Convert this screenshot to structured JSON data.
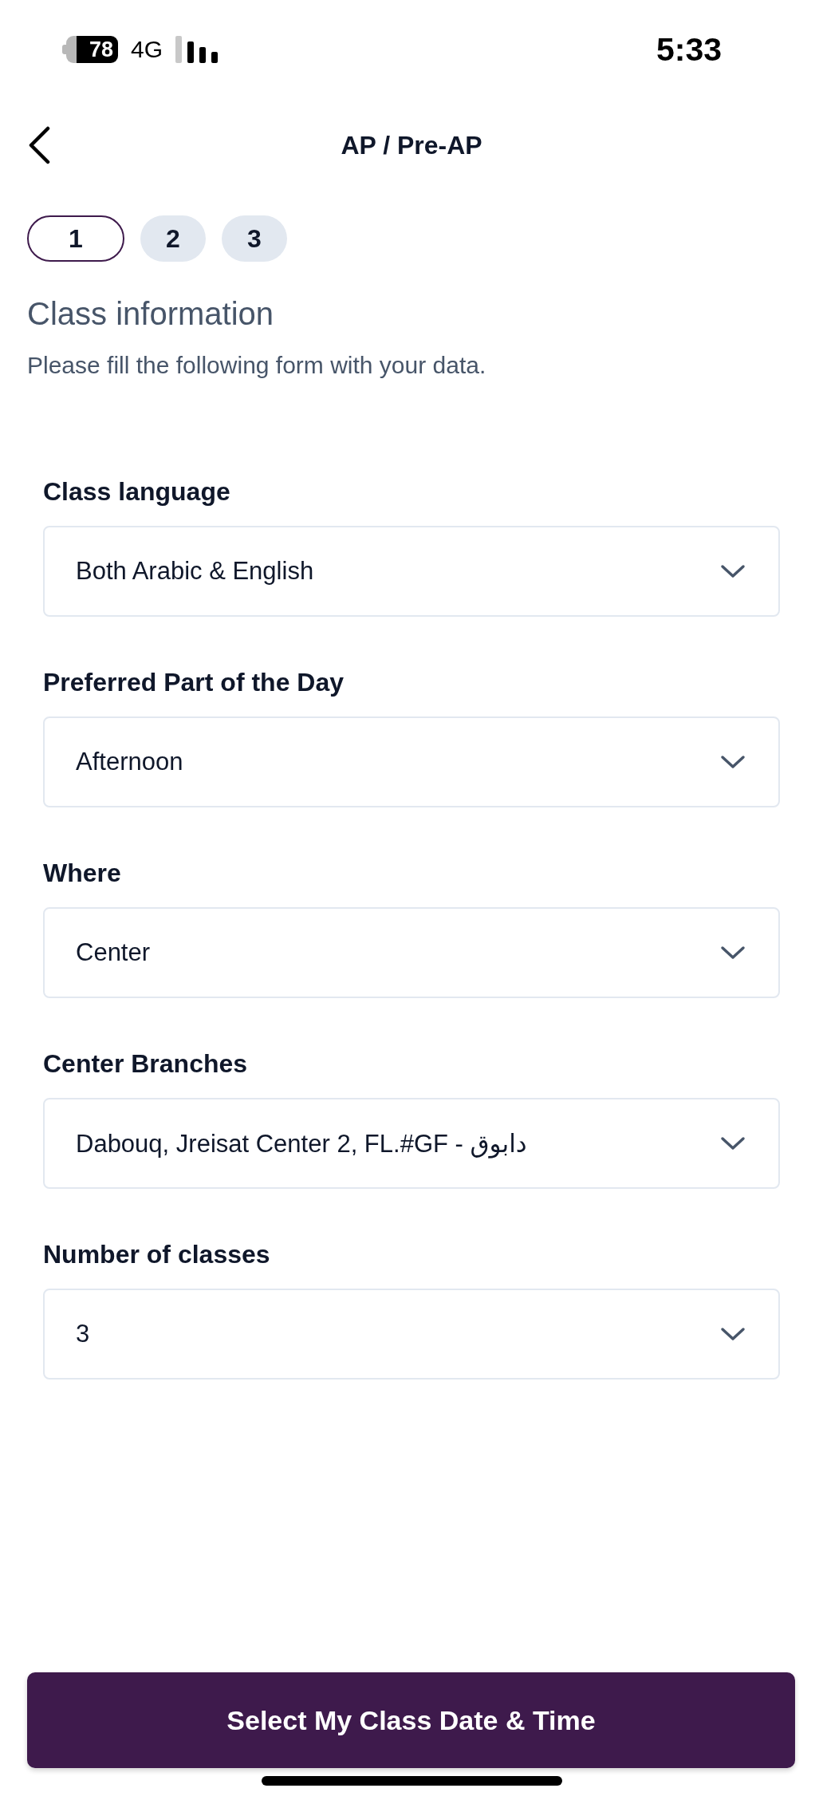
{
  "status_bar": {
    "battery": "78",
    "network": "4G",
    "time": "5:33"
  },
  "header": {
    "title": "AP / Pre-AP"
  },
  "steps": [
    {
      "label": "1",
      "selected": true
    },
    {
      "label": "2",
      "selected": false
    },
    {
      "label": "3",
      "selected": false
    }
  ],
  "section": {
    "title": "Class information",
    "subtitle": "Please fill the following form with your data."
  },
  "fields": [
    {
      "label": "Class language",
      "value": "Both Arabic & English"
    },
    {
      "label": "Preferred Part of the Day",
      "value": "Afternoon"
    },
    {
      "label": "Where",
      "value": "Center"
    },
    {
      "label": "Center Branches",
      "value": "Dabouq, Jreisat Center 2, FL.#GF - دابوق"
    },
    {
      "label": "Number of classes",
      "value": "3"
    }
  ],
  "submit_button": {
    "label": "Select My Class Date & Time"
  }
}
